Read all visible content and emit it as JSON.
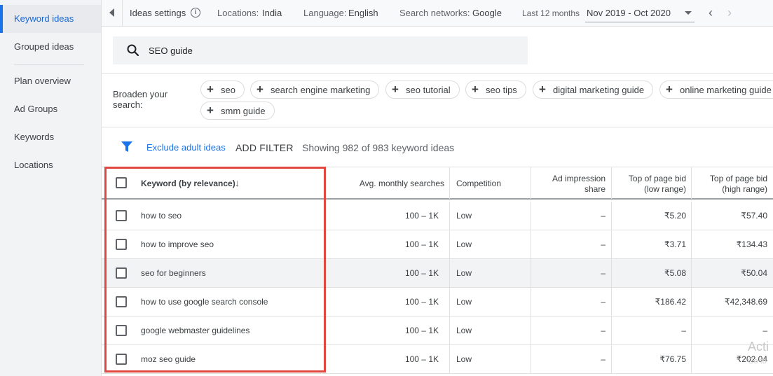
{
  "sidebar": {
    "items": [
      {
        "label": "Keyword ideas",
        "active": true
      },
      {
        "label": "Grouped ideas",
        "active": false
      },
      {
        "label": "Plan overview",
        "active": false
      },
      {
        "label": "Ad Groups",
        "active": false
      },
      {
        "label": "Keywords",
        "active": false
      },
      {
        "label": "Locations",
        "active": false
      }
    ]
  },
  "topbar": {
    "ideas_settings": "Ideas settings",
    "info_icon": "i",
    "locations_label": "Locations:",
    "locations_value": "India",
    "language_label": "Language:",
    "language_value": "English",
    "networks_label": "Search networks:",
    "networks_value": "Google",
    "period_label": "Last 12 months",
    "date_range": "Nov 2019 - Oct 2020"
  },
  "search": {
    "query": "SEO guide"
  },
  "broaden": {
    "label_line1": "Broaden your",
    "label_line2": "search:",
    "chips": [
      "seo",
      "search engine marketing",
      "seo tutorial",
      "seo tips",
      "digital marketing guide",
      "online marketing guide",
      "smm guide"
    ]
  },
  "filterbar": {
    "exclude_adult": "Exclude adult ideas",
    "add_filter": "ADD FILTER",
    "showing": "Showing 982 of 983 keyword ideas"
  },
  "table": {
    "headers": {
      "keyword": "Keyword (by relevance)",
      "searches": "Avg. monthly searches",
      "competition": "Competition",
      "impression_1": "Ad impression",
      "impression_2": "share",
      "bid_low_1": "Top of page bid",
      "bid_low_2": "(low range)",
      "bid_high_1": "Top of page bid",
      "bid_high_2": "(high range)"
    },
    "sort_icon": "↓",
    "rows": [
      {
        "keyword": "how to seo",
        "searches": "100 – 1K",
        "competition": "Low",
        "impression": "–",
        "bid_low": "₹5.20",
        "bid_high": "₹57.40"
      },
      {
        "keyword": "how to improve seo",
        "searches": "100 – 1K",
        "competition": "Low",
        "impression": "–",
        "bid_low": "₹3.71",
        "bid_high": "₹134.43"
      },
      {
        "keyword": "seo for beginners",
        "searches": "100 – 1K",
        "competition": "Low",
        "impression": "–",
        "bid_low": "₹5.08",
        "bid_high": "₹50.04"
      },
      {
        "keyword": "how to use google search console",
        "searches": "100 – 1K",
        "competition": "Low",
        "impression": "–",
        "bid_low": "₹186.42",
        "bid_high": "₹42,348.69"
      },
      {
        "keyword": "google webmaster guidelines",
        "searches": "100 – 1K",
        "competition": "Low",
        "impression": "–",
        "bid_low": "–",
        "bid_high": "–"
      },
      {
        "keyword": "moz seo guide",
        "searches": "100 – 1K",
        "competition": "Low",
        "impression": "–",
        "bid_low": "₹76.75",
        "bid_high": "₹202.04"
      }
    ]
  },
  "watermark": {
    "line1": "Acti",
    "line2": "Go to"
  },
  "colors": {
    "accent": "#1a73e8",
    "highlight_box": "#e0473f",
    "sidebar_bg": "#f1f3f4"
  }
}
